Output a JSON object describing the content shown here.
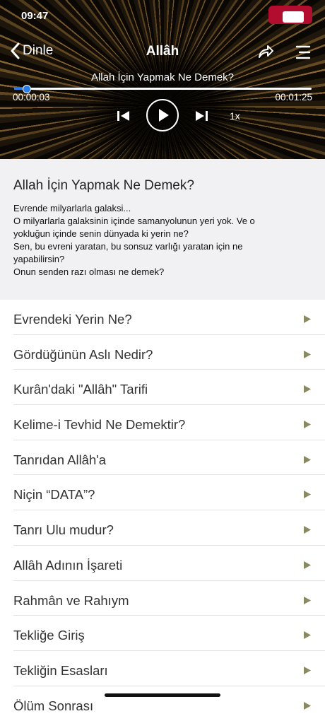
{
  "status": {
    "time": "09:47"
  },
  "nav": {
    "back_label": "Dinle",
    "title": "Allâh"
  },
  "player": {
    "track_title": "Allah İçin Yapmak Ne Demek?",
    "elapsed": "00:00:03",
    "total": "00:01:25",
    "progress_fraction": 0.04,
    "speed": "1x"
  },
  "description": {
    "title": "Allah İçin Yapmak Ne Demek?",
    "lines": [
      "Evrende milyarlarla galaksi...",
      "O milyarlarla galaksinin içinde samanyolunun yeri yok. Ve o",
      "yokluğun içinde senin dünyada ki yerin ne?",
      "Sen, bu evreni yaratan, bu sonsuz varlığı yaratan için ne",
      "yapabilirsin?",
      "Onun senden razı olması ne demek?"
    ]
  },
  "list": {
    "items": [
      "Evrendeki Yerin Ne?",
      "Gördüğünün Aslı Nedir?",
      "Kurân'daki \"Allâh\" Tarifi",
      "Kelime-i Tevhid Ne Demektir?",
      "Tanrıdan Allâh'a",
      "Niçin “DATA”?",
      "Tanrı Ulu mudur?",
      "Allâh Adının İşareti",
      "Rahmân ve Rahıym",
      "Tekliğe Giriş",
      "Tekliğin Esasları",
      "Ölüm Sonrası"
    ]
  },
  "colors": {
    "accent": "#2b7de9",
    "arrow": "#8a8a62"
  }
}
